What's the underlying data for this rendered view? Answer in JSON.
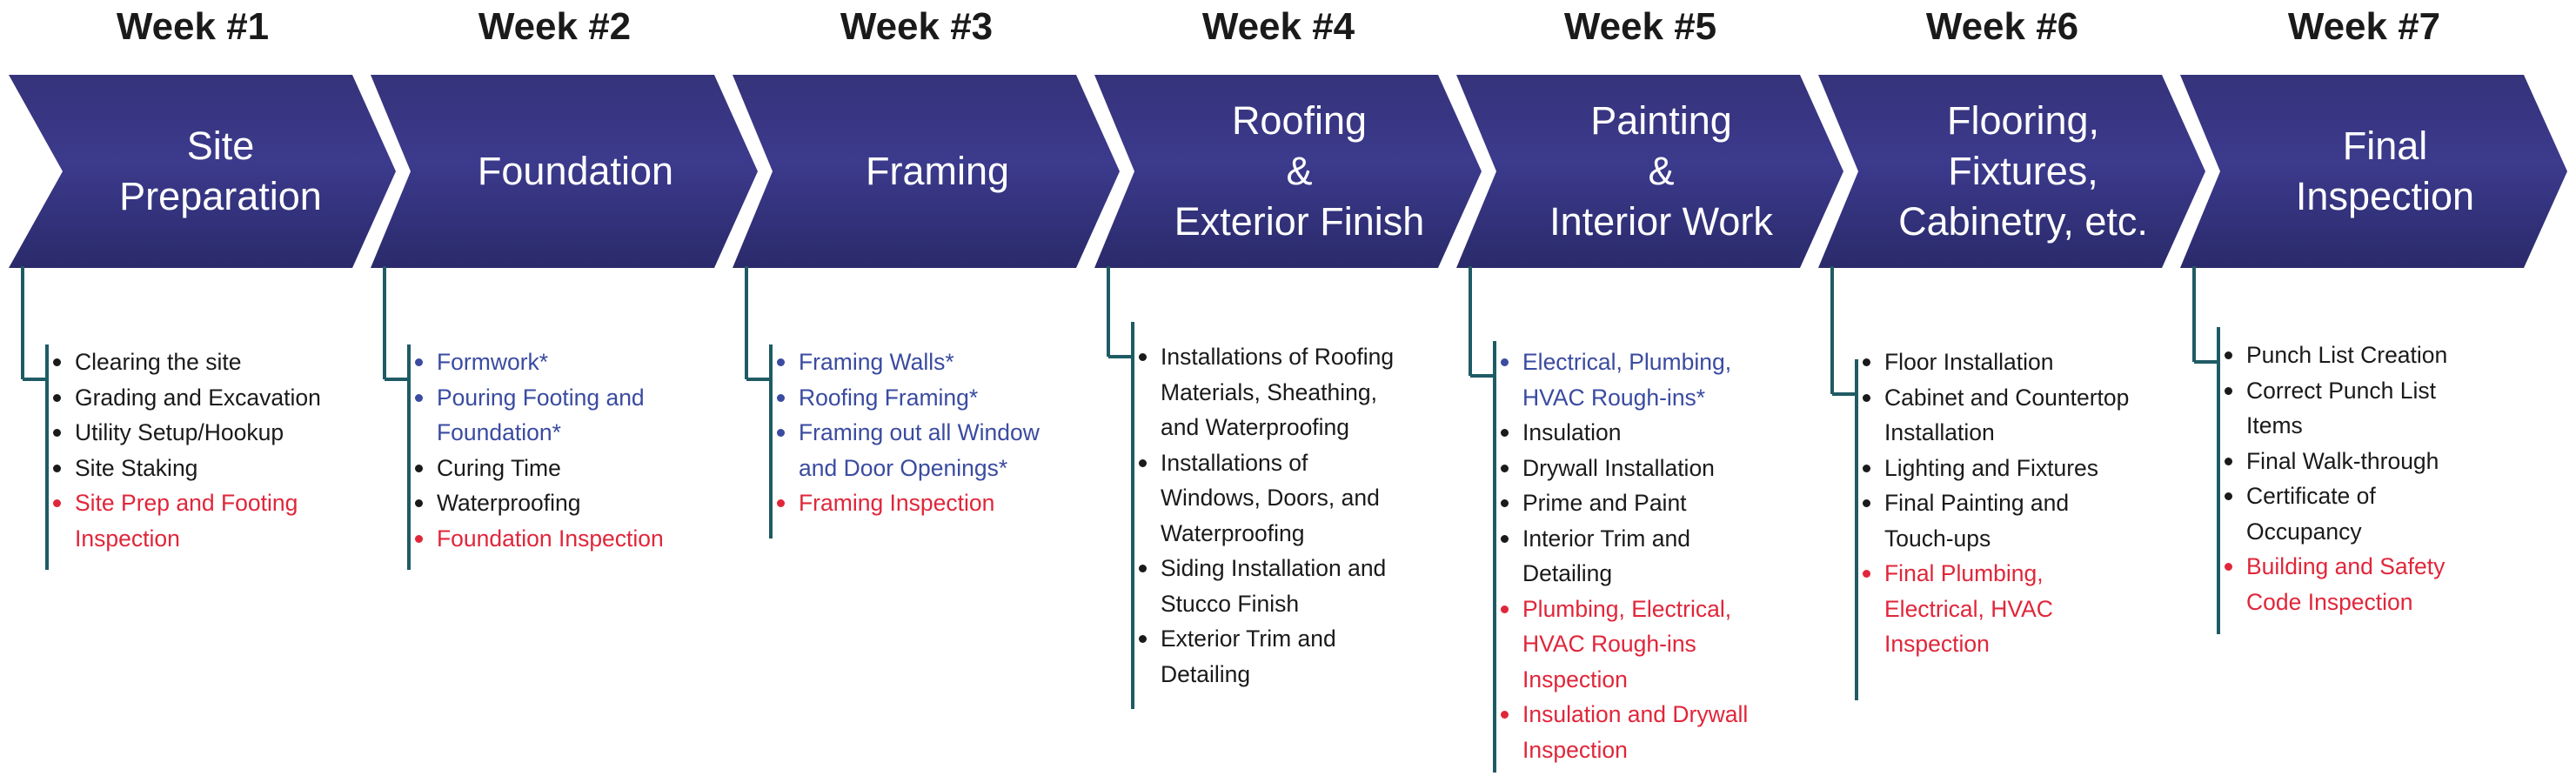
{
  "colors": {
    "arrow_top": "#35337a",
    "arrow_bottom": "#2a2a6b",
    "arrow_mid": "#3c3a8c",
    "bracket": "#1f5b64",
    "default_task": "#1a1a1a",
    "subcontract_task": "#3a4ba0",
    "inspection_task": "#e0263a"
  },
  "weeks": [
    {
      "header": "Week #1",
      "phase": [
        "Site",
        "Preparation"
      ],
      "tasks": [
        {
          "lines": [
            "Clearing the site"
          ],
          "kind": "default"
        },
        {
          "lines": [
            "Grading and Excavation"
          ],
          "kind": "default"
        },
        {
          "lines": [
            "Utility Setup/Hookup"
          ],
          "kind": "default"
        },
        {
          "lines": [
            "Site Staking"
          ],
          "kind": "default"
        },
        {
          "lines": [
            "Site Prep and Footing",
            "Inspection"
          ],
          "kind": "inspection"
        }
      ]
    },
    {
      "header": "Week #2",
      "phase": [
        "Foundation"
      ],
      "tasks": [
        {
          "lines": [
            "Formwork*"
          ],
          "kind": "subcontract"
        },
        {
          "lines": [
            "Pouring Footing and",
            "Foundation*"
          ],
          "kind": "subcontract"
        },
        {
          "lines": [
            "Curing Time"
          ],
          "kind": "default"
        },
        {
          "lines": [
            "Waterproofing"
          ],
          "kind": "default"
        },
        {
          "lines": [
            "Foundation Inspection"
          ],
          "kind": "inspection"
        }
      ]
    },
    {
      "header": "Week #3",
      "phase": [
        "Framing"
      ],
      "tasks": [
        {
          "lines": [
            "Framing Walls*"
          ],
          "kind": "subcontract"
        },
        {
          "lines": [
            "Roofing Framing*"
          ],
          "kind": "subcontract"
        },
        {
          "lines": [
            "Framing out all Window",
            "and Door Openings*"
          ],
          "kind": "subcontract"
        },
        {
          "lines": [
            "Framing Inspection"
          ],
          "kind": "inspection"
        }
      ]
    },
    {
      "header": "Week #4",
      "phase": [
        "Roofing",
        "&",
        "Exterior Finish"
      ],
      "tasks": [
        {
          "lines": [
            "Installations of Roofing",
            "Materials, Sheathing,",
            "and Waterproofing"
          ],
          "kind": "default"
        },
        {
          "lines": [
            "Installations of",
            "Windows, Doors, and",
            "Waterproofing"
          ],
          "kind": "default"
        },
        {
          "lines": [
            "Siding Installation and",
            "Stucco Finish"
          ],
          "kind": "default"
        },
        {
          "lines": [
            "Exterior Trim and",
            "Detailing"
          ],
          "kind": "default"
        }
      ]
    },
    {
      "header": "Week #5",
      "phase": [
        "Painting",
        "&",
        "Interior Work"
      ],
      "tasks": [
        {
          "lines": [
            "Electrical, Plumbing,",
            "HVAC Rough-ins*"
          ],
          "kind": "subcontract"
        },
        {
          "lines": [
            "Insulation"
          ],
          "kind": "default"
        },
        {
          "lines": [
            "Drywall Installation"
          ],
          "kind": "default"
        },
        {
          "lines": [
            "Prime and Paint"
          ],
          "kind": "default"
        },
        {
          "lines": [
            "Interior Trim and",
            "Detailing"
          ],
          "kind": "default"
        },
        {
          "lines": [
            "Plumbing, Electrical,",
            "HVAC Rough-ins",
            "Inspection"
          ],
          "kind": "inspection"
        },
        {
          "lines": [
            "Insulation and Drywall",
            "Inspection"
          ],
          "kind": "inspection"
        }
      ]
    },
    {
      "header": "Week #6",
      "phase": [
        "Flooring,",
        "Fixtures,",
        "Cabinetry, etc."
      ],
      "tasks": [
        {
          "lines": [
            "Floor Installation"
          ],
          "kind": "default"
        },
        {
          "lines": [
            "Cabinet and Countertop",
            "Installation"
          ],
          "kind": "default"
        },
        {
          "lines": [
            "Lighting and Fixtures"
          ],
          "kind": "default"
        },
        {
          "lines": [
            "Final Painting and",
            "Touch-ups"
          ],
          "kind": "default"
        },
        {
          "lines": [
            "Final Plumbing,",
            "Electrical, HVAC",
            "Inspection"
          ],
          "kind": "inspection"
        }
      ]
    },
    {
      "header": "Week #7",
      "phase": [
        "Final",
        "Inspection"
      ],
      "tasks": [
        {
          "lines": [
            "Punch List Creation"
          ],
          "kind": "default"
        },
        {
          "lines": [
            "Correct Punch List",
            "Items"
          ],
          "kind": "default"
        },
        {
          "lines": [
            "Final Walk-through"
          ],
          "kind": "default"
        },
        {
          "lines": [
            "Certificate of",
            "Occupancy"
          ],
          "kind": "default"
        },
        {
          "lines": [
            "Building and Safety",
            "Code Inspection"
          ],
          "kind": "inspection"
        }
      ]
    }
  ]
}
